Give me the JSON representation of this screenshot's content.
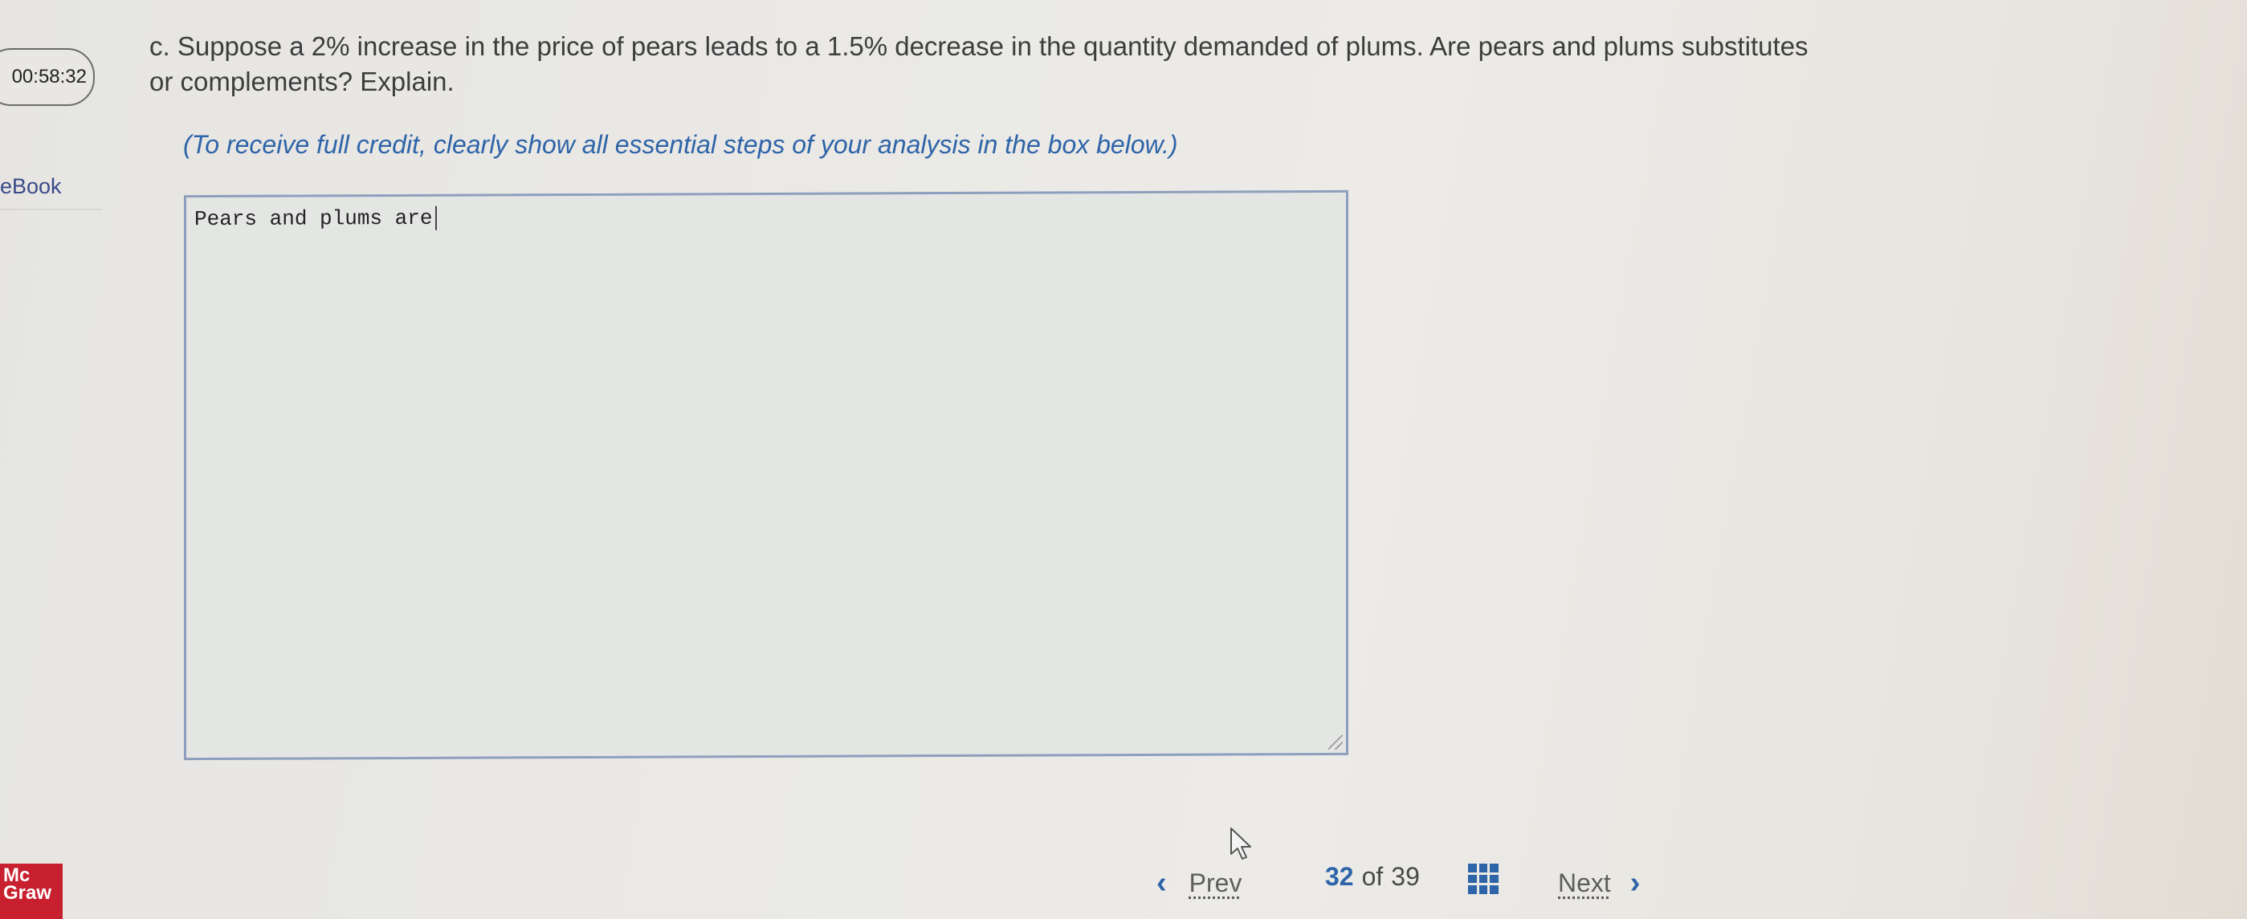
{
  "timer": {
    "value": "00:58:32"
  },
  "sidebar": {
    "ebook_label": "eBook",
    "logo_text_line1": "Mc",
    "logo_text_line2": "Graw"
  },
  "question": {
    "text": "c. Suppose a 2% increase in the price of pears leads to a 1.5% decrease in the quantity demanded of plums. Are pears and plums substitutes or complements? Explain.",
    "instruction": "(To receive full credit, clearly show all essential steps of your analysis in the box below.)"
  },
  "answer": {
    "value": "Pears and plums are"
  },
  "navigation": {
    "prev_label": "Prev",
    "next_label": "Next",
    "current_page": "32",
    "of_label": "of",
    "total_pages": "39",
    "grid_icon": "grid-icon"
  },
  "colors": {
    "accent": "#2e64a8",
    "brand": "#c8202e"
  }
}
